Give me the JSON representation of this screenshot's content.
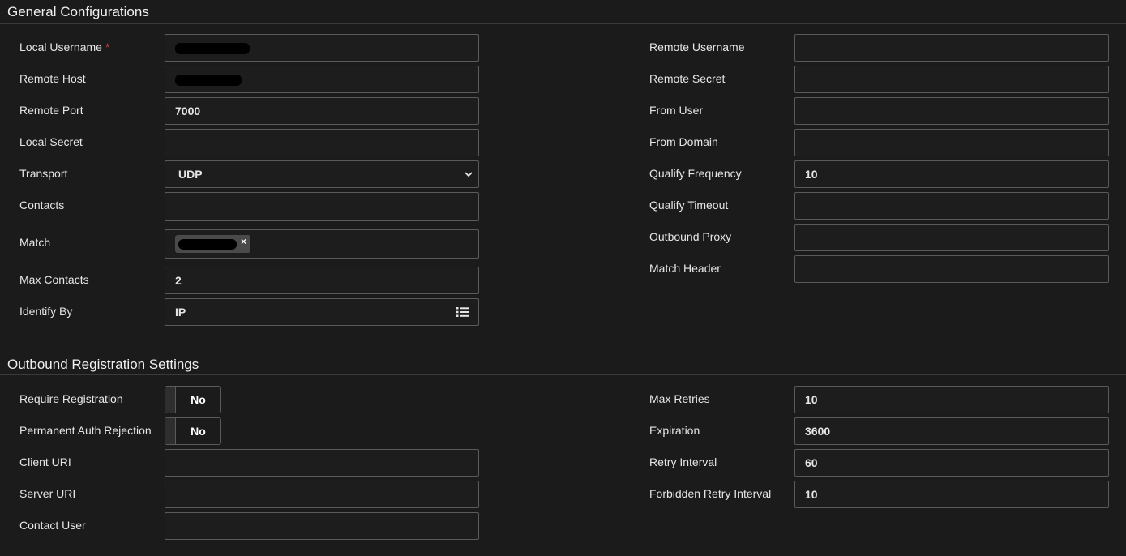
{
  "general": {
    "title": "General Configurations",
    "left": {
      "local_username": {
        "label": "Local Username",
        "required_mark": "*",
        "value": ""
      },
      "remote_host": {
        "label": "Remote Host",
        "value": ""
      },
      "remote_port": {
        "label": "Remote Port",
        "value": "7000"
      },
      "local_secret": {
        "label": "Local Secret",
        "value": ""
      },
      "transport": {
        "label": "Transport",
        "value": "UDP"
      },
      "contacts": {
        "label": "Contacts",
        "value": ""
      },
      "match": {
        "label": "Match",
        "tag_remove": "×"
      },
      "max_contacts": {
        "label": "Max Contacts",
        "value": "2"
      },
      "identify_by": {
        "label": "Identify By",
        "value": "IP"
      }
    },
    "right": {
      "remote_username": {
        "label": "Remote Username",
        "value": ""
      },
      "remote_secret": {
        "label": "Remote Secret",
        "value": ""
      },
      "from_user": {
        "label": "From User",
        "value": ""
      },
      "from_domain": {
        "label": "From Domain",
        "value": ""
      },
      "qualify_frequency": {
        "label": "Qualify Frequency",
        "value": "10"
      },
      "qualify_timeout": {
        "label": "Qualify Timeout",
        "value": ""
      },
      "outbound_proxy": {
        "label": "Outbound Proxy",
        "value": ""
      },
      "match_header": {
        "label": "Match Header",
        "value": ""
      }
    }
  },
  "outbound": {
    "title": "Outbound Registration Settings",
    "left": {
      "require_registration": {
        "label": "Require Registration",
        "value": "No"
      },
      "permanent_auth_rejection": {
        "label": "Permanent Auth Rejection",
        "value": "No"
      },
      "client_uri": {
        "label": "Client URI",
        "value": ""
      },
      "server_uri": {
        "label": "Server URI",
        "value": ""
      },
      "contact_user": {
        "label": "Contact User",
        "value": ""
      }
    },
    "right": {
      "max_retries": {
        "label": "Max Retries",
        "value": "10"
      },
      "expiration": {
        "label": "Expiration",
        "value": "3600"
      },
      "retry_interval": {
        "label": "Retry Interval",
        "value": "60"
      },
      "forbidden_retry_interval": {
        "label": "Forbidden Retry Interval",
        "value": "10"
      }
    }
  },
  "icons": {
    "identify_by_button": "list-icon",
    "transport_arrow": "chevron-down-icon"
  },
  "colors": {
    "background": "#1b1b1b",
    "required": "#e03b3b",
    "border": "#5a5a5a"
  }
}
